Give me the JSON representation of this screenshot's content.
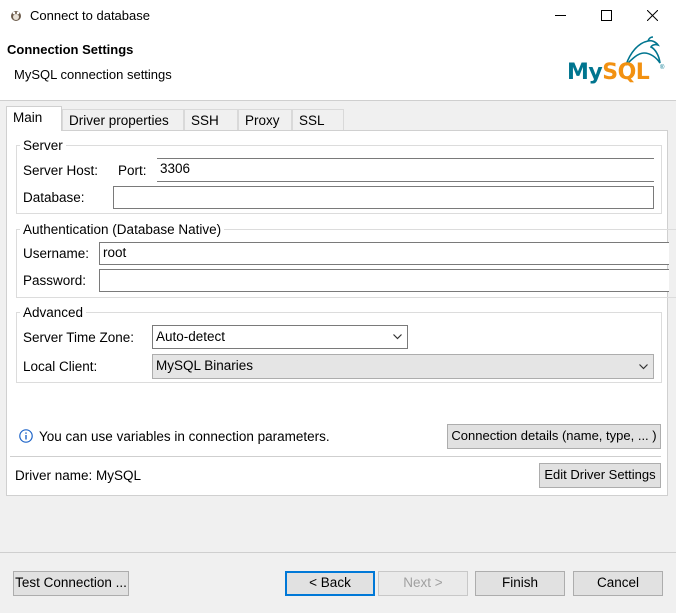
{
  "window": {
    "title": "Connect to database",
    "minimize_glyph": "—",
    "maximize_glyph": "☐",
    "close_glyph": "✕"
  },
  "header": {
    "title": "Connection Settings",
    "subtitle": "MySQL connection settings",
    "logo_text": "MySQL"
  },
  "tabs": [
    {
      "label": "Main",
      "active": true
    },
    {
      "label": "Driver properties",
      "active": false
    },
    {
      "label": "SSH",
      "active": false
    },
    {
      "label": "Proxy",
      "active": false
    },
    {
      "label": "SSL",
      "active": false
    }
  ],
  "server": {
    "legend": "Server",
    "host_label": "Server Host:",
    "host_value": "",
    "port_label": "Port:",
    "port_value": "3306",
    "database_label": "Database:",
    "database_value": ""
  },
  "auth": {
    "legend": "Authentication (Database Native)",
    "username_label": "Username:",
    "username_value": "root",
    "password_label": "Password:",
    "password_value": ""
  },
  "advanced": {
    "legend": "Advanced",
    "timezone_label": "Server Time Zone:",
    "timezone_value": "Auto-detect",
    "local_client_label": "Local Client:",
    "local_client_value": "MySQL Binaries"
  },
  "info": {
    "icon": "info-icon",
    "text": "You can use variables in connection parameters.",
    "details_button": "Connection details (name, type, ... )"
  },
  "driver": {
    "name_text": "Driver name: MySQL",
    "edit_button": "Edit Driver Settings"
  },
  "footer": {
    "test_button": "Test Connection ...",
    "back_button": "< Back",
    "next_button": "Next >",
    "finish_button": "Finish",
    "cancel_button": "Cancel"
  },
  "colors": {
    "accent": "#0078d7",
    "mysql_blue": "#00758f",
    "mysql_orange": "#f29111",
    "info_blue": "#1e64c8"
  }
}
